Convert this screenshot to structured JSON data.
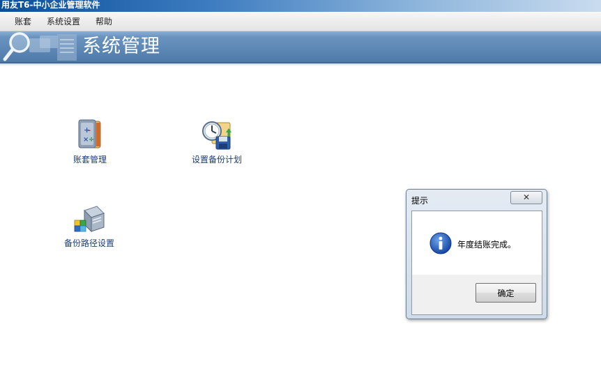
{
  "window": {
    "title": "用友T6-中小企业管理软件"
  },
  "menu": [
    {
      "label": "账套"
    },
    {
      "label": "系统设置"
    },
    {
      "label": "帮助"
    }
  ],
  "banner": {
    "title": "系统管理"
  },
  "modules": [
    {
      "label": "账套管理",
      "icon": "account-set-icon"
    },
    {
      "label": "设置备份计划",
      "icon": "backup-schedule-icon"
    },
    {
      "label": "备份路径设置",
      "icon": "backup-path-icon"
    }
  ],
  "dialog": {
    "title": "提示",
    "close_symbol": "✕",
    "message": "年度结账完成。",
    "ok_label": "确定",
    "icon": "info-icon"
  },
  "colors": {
    "banner": "#5c86b4",
    "title_bar": "#0b4f9a",
    "link_text": "#1c3c78"
  }
}
